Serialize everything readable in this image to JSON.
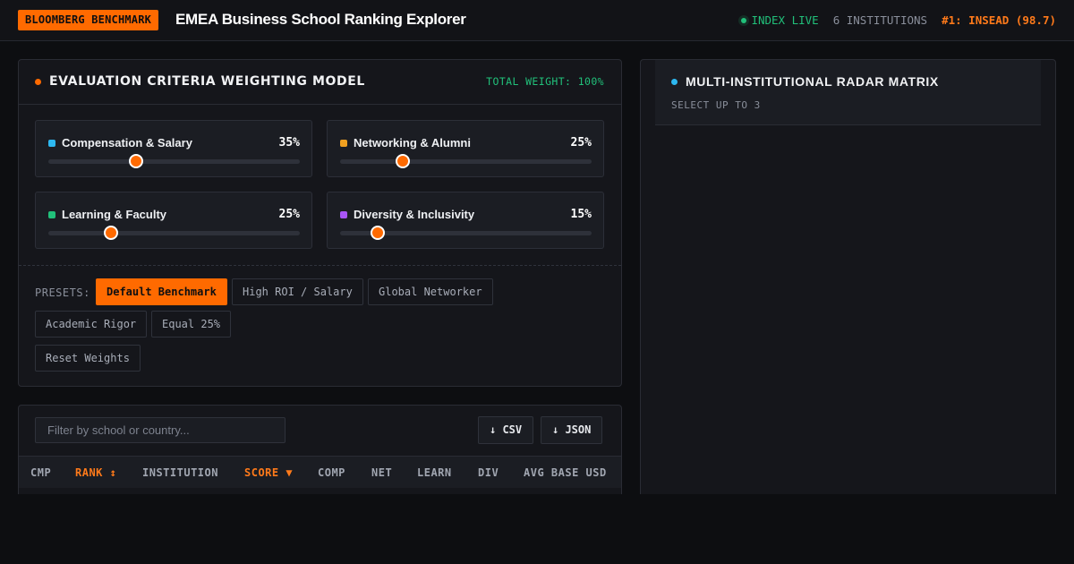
{
  "header": {
    "brand": "BLOOMBERG BENCHMARK",
    "title": "EMEA Business School Ranking Explorer",
    "live_label": "INDEX LIVE",
    "institutions": "6 INSTITUTIONS",
    "leader": "#1: INSEAD (98.7)"
  },
  "colors": {
    "accent": "#ff6a00",
    "live": "#21c07a",
    "compensation": "#2db8f0",
    "networking": "#f0a020",
    "learning": "#21c07a",
    "diversity": "#a855f7",
    "radar_dot": "#2db8f0"
  },
  "weights": {
    "title": "EVALUATION CRITERIA WEIGHTING MODEL",
    "total": "TOTAL WEIGHT: 100%",
    "criteria": [
      {
        "label": "Compensation & Salary",
        "pct_label": "35%",
        "value": 35
      },
      {
        "label": "Networking & Alumni",
        "pct_label": "25%",
        "value": 25
      },
      {
        "label": "Learning & Faculty",
        "pct_label": "25%",
        "value": 25
      },
      {
        "label": "Diversity & Inclusivity",
        "pct_label": "15%",
        "value": 15
      }
    ],
    "presets_label": "PRESETS:",
    "presets": [
      "Default Benchmark",
      "High ROI / Salary",
      "Global Networker",
      "Academic Rigor",
      "Equal 25%"
    ],
    "reset": "Reset Weights"
  },
  "table": {
    "filter_placeholder": "Filter by school or country...",
    "csv": "↓ CSV",
    "json": "↓ JSON",
    "columns": [
      "CMP",
      "RANK ↕",
      "INSTITUTION",
      "SCORE ▼",
      "COMP",
      "NET",
      "LEARN",
      "DIV",
      "AVG BASE USD"
    ]
  },
  "radar": {
    "title": "MULTI-INSTITUTIONAL RADAR MATRIX",
    "subtitle": "SELECT UP TO 3"
  }
}
